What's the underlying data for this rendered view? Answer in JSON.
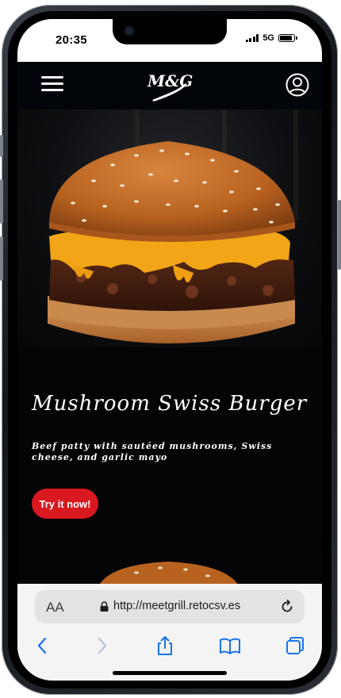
{
  "status_bar": {
    "time": "20:35",
    "network": "5G"
  },
  "navbar": {
    "logo": "M&G"
  },
  "hero": {
    "title": "Mushroom Swiss Burger",
    "description": "Beef patty with sautéed mushrooms, Swiss cheese, and garlic mayo",
    "cta_label": "Try it now!"
  },
  "browser": {
    "text_size_label": "AA",
    "url": "http://meetgrill.retocsv.es",
    "accent_color": "#1a73e8"
  },
  "colors": {
    "page_background": "#030405",
    "cta": "#d9181f",
    "title": "#ffffff"
  }
}
